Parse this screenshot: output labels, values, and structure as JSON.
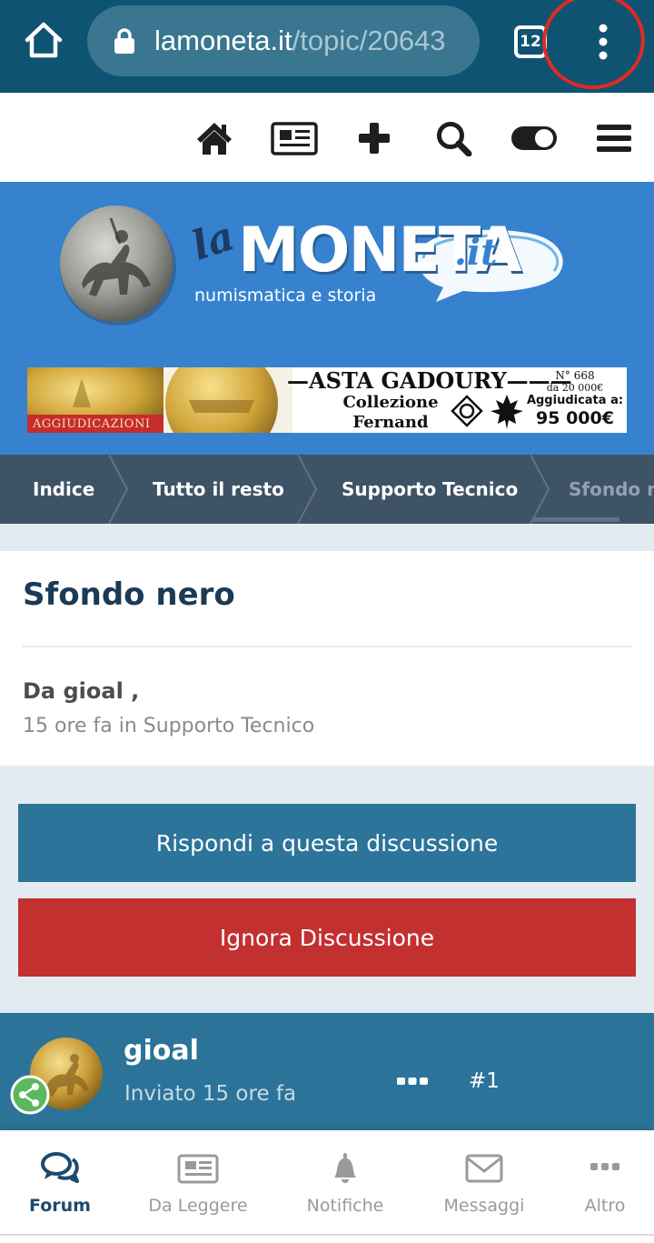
{
  "browser": {
    "url_host": "lamoneta.it",
    "url_path": "/topic/20643",
    "tab_count": "12"
  },
  "site_header": {
    "logo_prefix": "la",
    "logo_main": "MONETA",
    "logo_suffix": ".it",
    "logo_tagline": "numismatica e storia",
    "banner": {
      "ribbon": "AGGIUDICAZIONI",
      "title": "—ASTA GADOURY———",
      "collection_line1": "Collezione",
      "collection_line2": "Fernand DAVID",
      "lot_number": "N° 668",
      "estimate": "da 20 000€",
      "sold_label": "Aggiudicata a:",
      "price": "95 000€"
    }
  },
  "breadcrumb": [
    {
      "label": "Indice"
    },
    {
      "label": "Tutto il resto"
    },
    {
      "label": "Supporto Tecnico"
    },
    {
      "label": "Sfondo n"
    }
  ],
  "topic": {
    "title": "Sfondo nero",
    "author_line": "Da gioal ,",
    "meta": "15 ore fa in Supporto Tecnico"
  },
  "actions": {
    "reply": "Rispondi a questa discussione",
    "ignore": "Ignora Discussione"
  },
  "post": {
    "author": "gioal",
    "time": "Inviato 15 ore fa",
    "number": "#1"
  },
  "bottom_nav": [
    {
      "label": "Forum",
      "icon": "chat-bubbles-icon",
      "active": true
    },
    {
      "label": "Da Leggere",
      "icon": "newspaper-icon",
      "active": false
    },
    {
      "label": "Notifiche",
      "icon": "bell-icon",
      "active": false
    },
    {
      "label": "Messaggi",
      "icon": "envelope-icon",
      "active": false
    },
    {
      "label": "Altro",
      "icon": "more-dots-icon",
      "active": false
    }
  ],
  "colors": {
    "browser_bar": "#0f5372",
    "header_blue": "#3682cf",
    "breadcrumb_bg": "#3e5365",
    "reply_button": "#2c7499",
    "ignore_button": "#c33030",
    "post_header": "#2c7399",
    "annotation_circle": "#e02a22"
  }
}
